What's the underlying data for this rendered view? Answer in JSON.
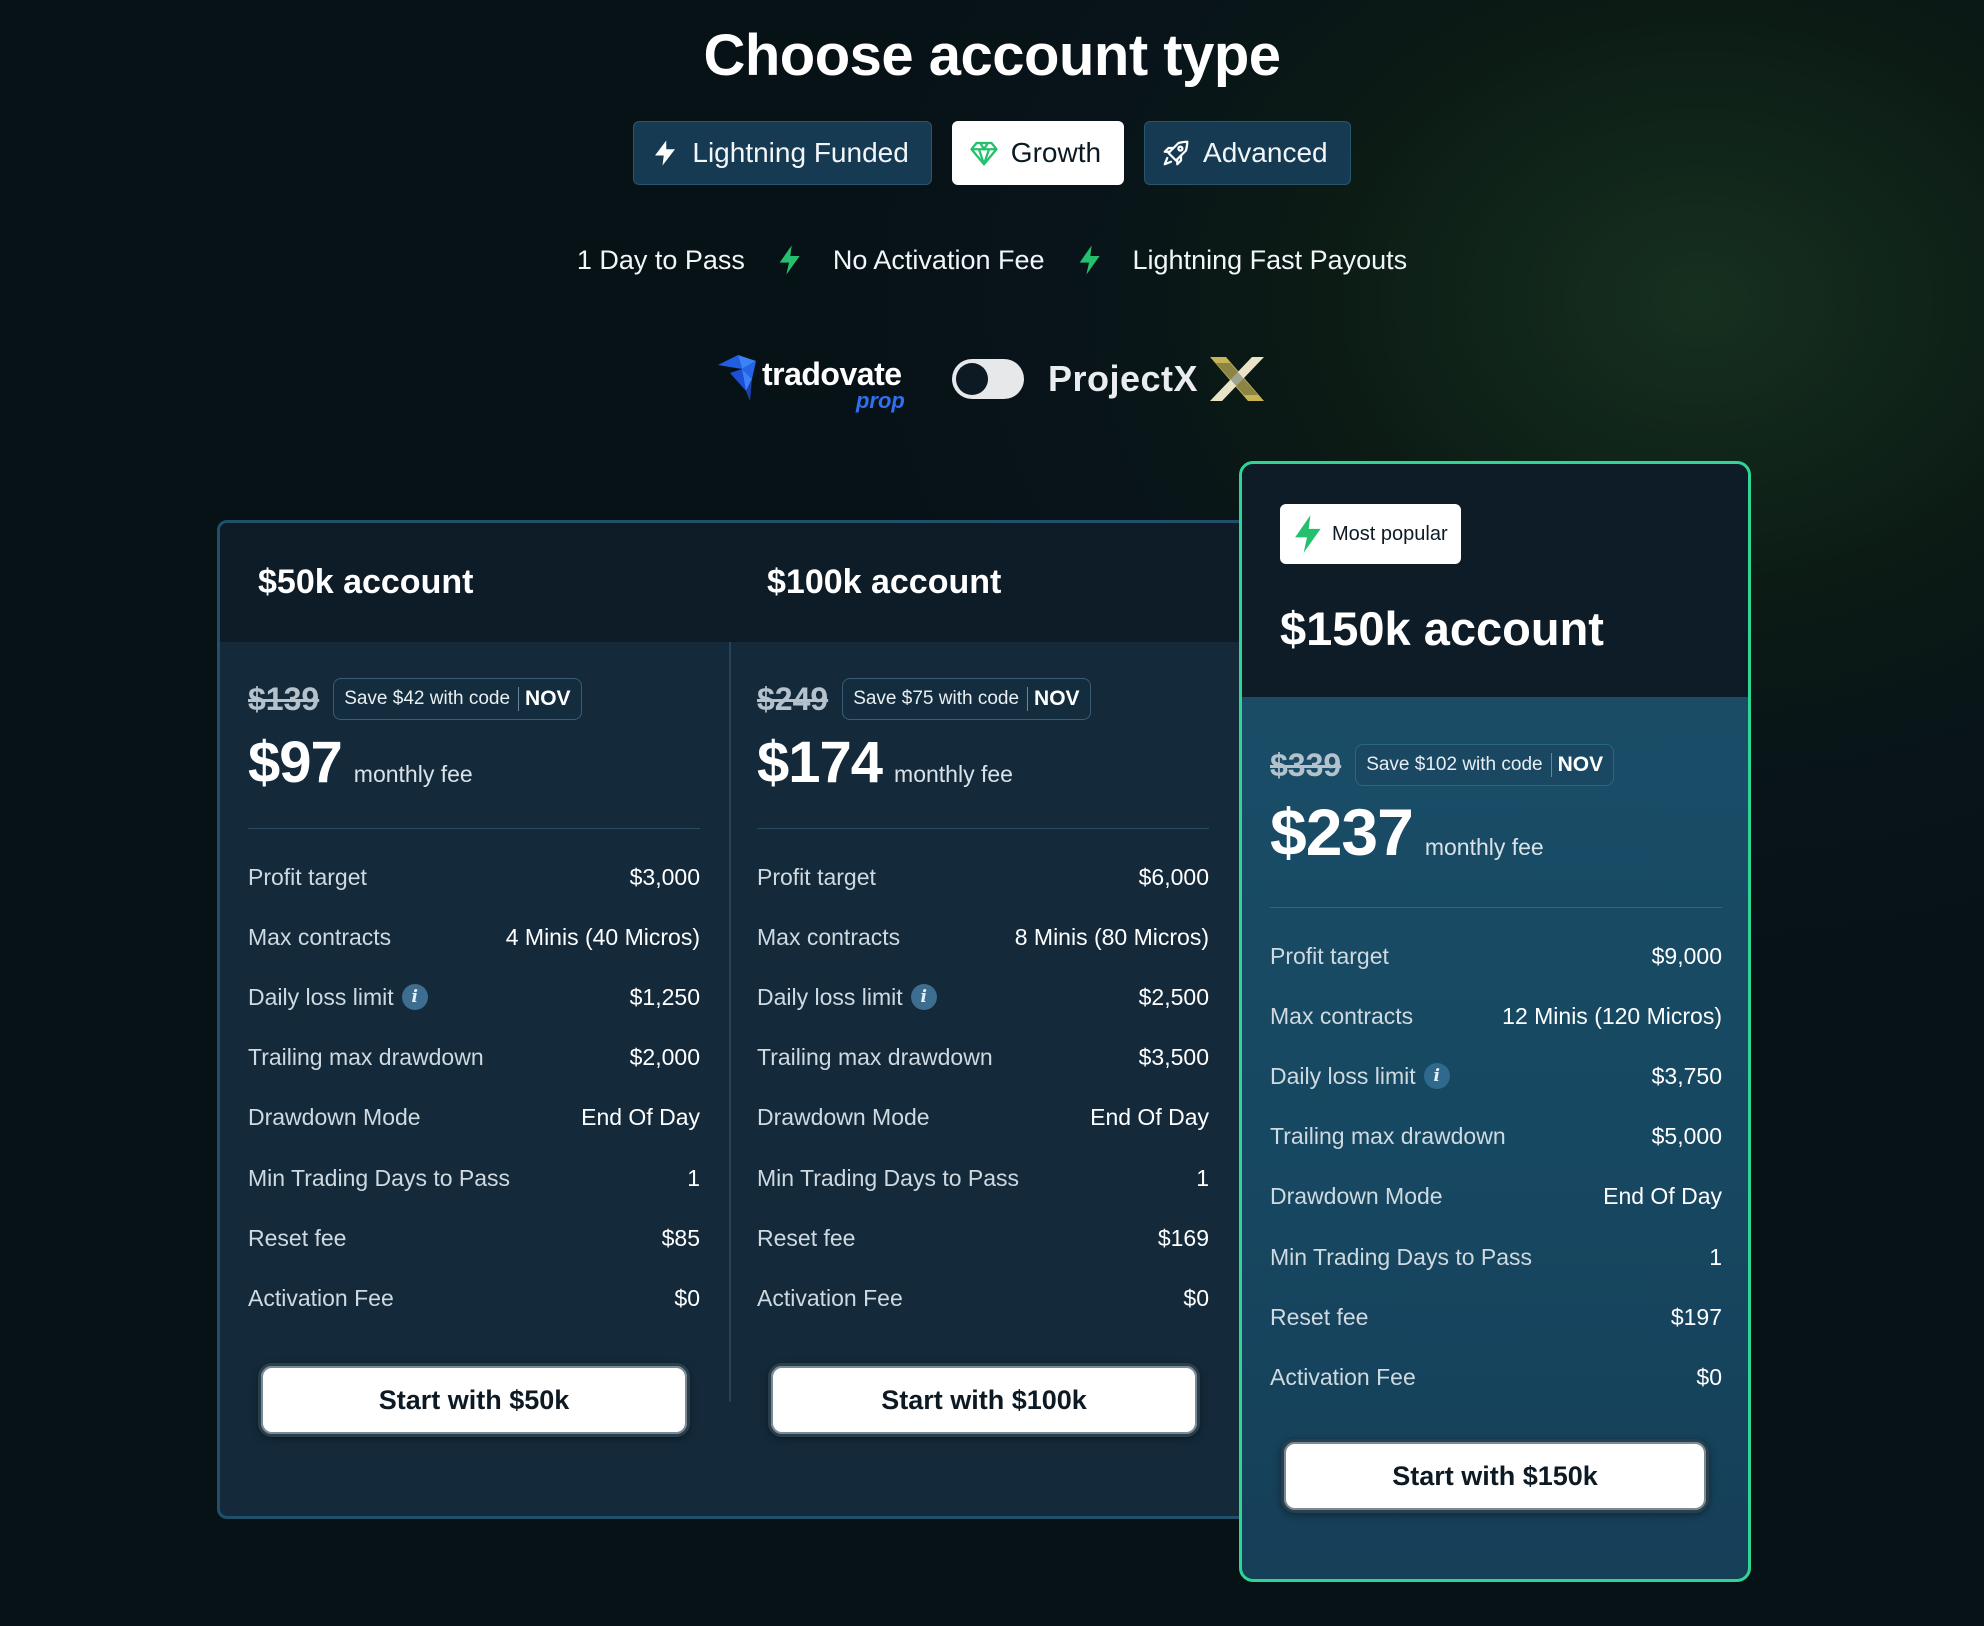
{
  "page": {
    "title": "Choose account type"
  },
  "tabs": [
    {
      "label": "Lightning Funded",
      "icon": "bolt-icon",
      "active": false
    },
    {
      "label": "Growth",
      "icon": "diamond-icon",
      "active": true
    },
    {
      "label": "Advanced",
      "icon": "rocket-icon",
      "active": false
    }
  ],
  "features": [
    "1 Day to Pass",
    "No Activation Fee",
    "Lightning Fast Payouts"
  ],
  "platforms": {
    "left": {
      "name": "tradovate",
      "sub": "prop"
    },
    "right": {
      "name": "ProjectX"
    },
    "toggle_on": false
  },
  "colors": {
    "accent": "#2fd592",
    "bolt": "#25c06d",
    "panel": "#142a3b",
    "featured": "#1b4f69"
  },
  "cards": [
    {
      "name": "$50k account",
      "old_price": "$139",
      "promo_text": "Save $42 with code",
      "promo_code": "NOV",
      "price": "$97",
      "price_note": "monthly fee",
      "specs": [
        {
          "label": "Profit target",
          "value": "$3,000"
        },
        {
          "label": "Max contracts",
          "value": "4 Minis (40 Micros)"
        },
        {
          "label": "Daily loss limit",
          "value": "$1,250",
          "info": "i"
        },
        {
          "label": "Trailing max drawdown",
          "value": "$2,000"
        },
        {
          "label": "Drawdown Mode",
          "value": "End Of Day"
        },
        {
          "label": "Min Trading Days to Pass",
          "value": "1"
        },
        {
          "label": "Reset fee",
          "value": "$85"
        },
        {
          "label": "Activation Fee",
          "value": "$0"
        }
      ],
      "cta": "Start with $50k"
    },
    {
      "name": "$100k account",
      "old_price": "$249",
      "promo_text": "Save $75 with code",
      "promo_code": "NOV",
      "price": "$174",
      "price_note": "monthly fee",
      "specs": [
        {
          "label": "Profit target",
          "value": "$6,000"
        },
        {
          "label": "Max contracts",
          "value": "8 Minis (80 Micros)"
        },
        {
          "label": "Daily loss limit",
          "value": "$2,500",
          "info": "i"
        },
        {
          "label": "Trailing max drawdown",
          "value": "$3,500"
        },
        {
          "label": "Drawdown Mode",
          "value": "End Of Day"
        },
        {
          "label": "Min Trading Days to Pass",
          "value": "1"
        },
        {
          "label": "Reset fee",
          "value": "$169"
        },
        {
          "label": "Activation Fee",
          "value": "$0"
        }
      ],
      "cta": "Start with $100k"
    },
    {
      "badge": "Most popular",
      "name": "$150k account",
      "old_price": "$339",
      "promo_text": "Save $102 with code",
      "promo_code": "NOV",
      "price": "$237",
      "price_note": "monthly fee",
      "specs": [
        {
          "label": "Profit target",
          "value": "$9,000"
        },
        {
          "label": "Max contracts",
          "value": "12 Minis (120 Micros)"
        },
        {
          "label": "Daily loss limit",
          "value": "$3,750",
          "info": "i"
        },
        {
          "label": "Trailing max drawdown",
          "value": "$5,000"
        },
        {
          "label": "Drawdown Mode",
          "value": "End Of Day"
        },
        {
          "label": "Min Trading Days to Pass",
          "value": "1"
        },
        {
          "label": "Reset fee",
          "value": "$197"
        },
        {
          "label": "Activation Fee",
          "value": "$0"
        }
      ],
      "cta": "Start with $150k"
    }
  ]
}
